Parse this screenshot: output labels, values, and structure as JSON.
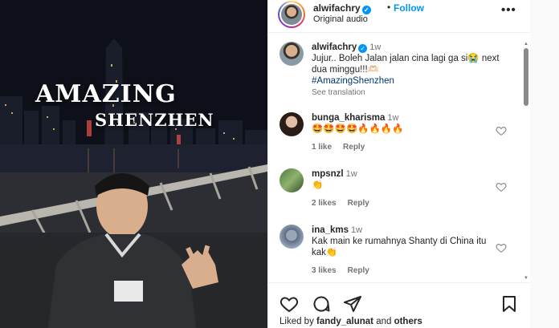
{
  "photo": {
    "title_line1": "AMAZING",
    "title_line2": "SHENZHEN"
  },
  "header": {
    "username": "alwifachry",
    "follow_dot": "•",
    "follow_label": "Follow",
    "subtitle": "Original audio",
    "more_label": "•••"
  },
  "comments": [
    {
      "username": "alwifachry",
      "time": "1w",
      "text": "Jujur.. Boleh Jalan jalan cina lagi ga si😭 next dua minggu!!!🫶🏻",
      "hashtag": "#AmazingShenzhen",
      "see_translation": "See translation"
    },
    {
      "username": "bunga_kharisma",
      "time": "1w",
      "text": "🤩🤩🤩🤩🔥🔥🔥🔥",
      "likes": "1 like",
      "reply": "Reply"
    },
    {
      "username": "mpsnzl",
      "time": "1w",
      "text": "👏",
      "likes": "2 likes",
      "reply": "Reply"
    },
    {
      "username": "ina_kms",
      "time": "1w",
      "text": "Kak main ke rumahnya Shanty di China itu kak👏",
      "likes": "3 likes",
      "reply": "Reply"
    }
  ],
  "footer": {
    "liked_prefix": "Liked by",
    "liked_user": "fandy_alunat",
    "liked_and": "and",
    "liked_others": "others"
  },
  "icons": {
    "heart": "heart-icon",
    "comment": "comment-icon",
    "share": "share-icon",
    "save": "bookmark-icon",
    "verified": "verified-badge-icon"
  },
  "colors": {
    "accent": "#0095f6",
    "text": "#262626",
    "muted": "#737373",
    "hashtag": "#00376b"
  }
}
